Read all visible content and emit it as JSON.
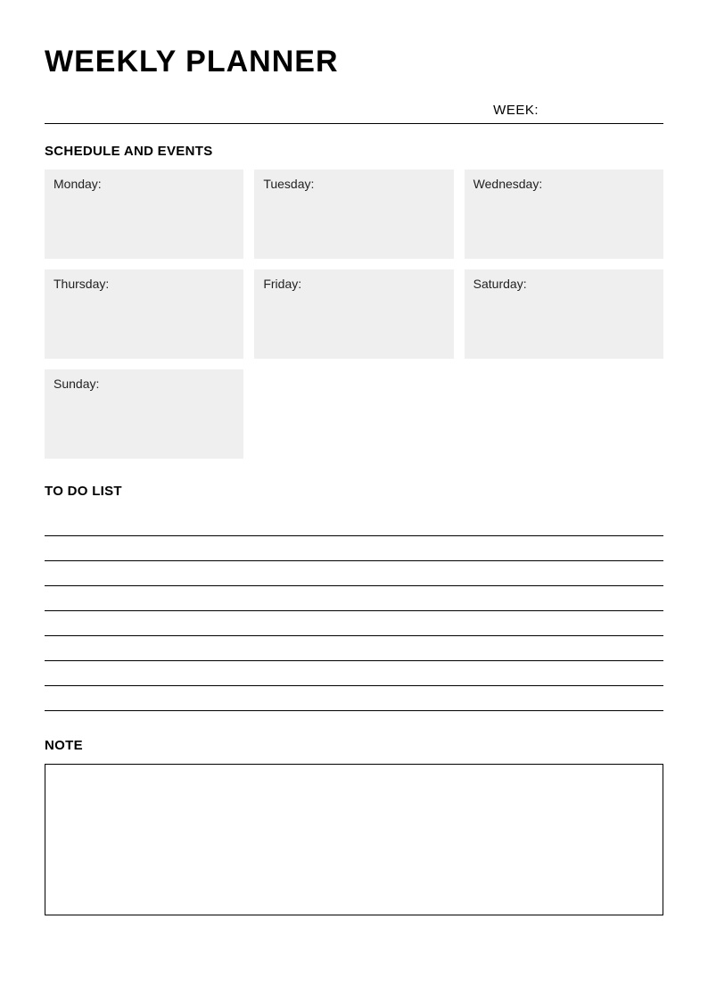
{
  "title": "WEEKLY PLANNER",
  "week_label": "WEEK:",
  "schedule": {
    "heading": "SCHEDULE AND EVENTS",
    "days": [
      {
        "label": "Monday:"
      },
      {
        "label": "Tuesday:"
      },
      {
        "label": "Wednesday:"
      },
      {
        "label": "Thursday:"
      },
      {
        "label": "Friday:"
      },
      {
        "label": "Saturday:"
      },
      {
        "label": "Sunday:"
      }
    ]
  },
  "todo": {
    "heading": "TO DO LIST",
    "line_count": 8
  },
  "note": {
    "heading": "NOTE"
  }
}
